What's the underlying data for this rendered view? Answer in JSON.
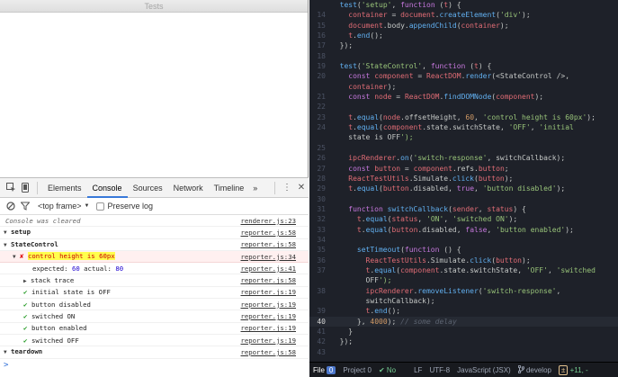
{
  "window": {
    "title": "Tests"
  },
  "devtools": {
    "tabs": [
      "Elements",
      "Console",
      "Sources",
      "Network",
      "Timeline"
    ],
    "active_tab": "Console",
    "more": "»",
    "menu": "⋮",
    "close": "✕",
    "frame": "<top frame>",
    "frame_arrow": "▼",
    "preserve_log": "Preserve log"
  },
  "console": {
    "cleared": {
      "text": "Console was cleared",
      "src": "renderer.js:23"
    },
    "setup": {
      "text": "setup",
      "src": "reporter.js:58"
    },
    "statecontrol": {
      "text": "StateControl",
      "src": "reporter.js:58"
    },
    "fail": {
      "text": "control height is 60px",
      "src": "reporter.js:34"
    },
    "expected": {
      "label_expected": "expected:",
      "expected": "60",
      "label_actual": "actual:",
      "actual": "80",
      "src": "reporter.js:41"
    },
    "stack": {
      "text": "stack trace",
      "src": "reporter.js:58"
    },
    "passes": [
      {
        "text": "initial state is OFF",
        "src": "reporter.js:19"
      },
      {
        "text": "button disabled",
        "src": "reporter.js:19"
      },
      {
        "text": "switched ON",
        "src": "reporter.js:19"
      },
      {
        "text": "button enabled",
        "src": "reporter.js:19"
      },
      {
        "text": "switched OFF",
        "src": "reporter.js:19"
      }
    ],
    "teardown": {
      "text": "teardown",
      "src": "reporter.js:58"
    },
    "prompt": ">"
  },
  "editor": {
    "colors": {
      "background": "#1e2129",
      "keyword": "#c678dd",
      "function": "#61afef",
      "string": "#98c379",
      "number": "#d19a66"
    },
    "current_line": 40,
    "lines": [
      {
        "no": "",
        "code": "  test('setup', function (t) {"
      },
      {
        "no": "14",
        "code": "    container = document.createElement('div');"
      },
      {
        "no": "15",
        "code": "    document.body.appendChild(container);"
      },
      {
        "no": "16",
        "code": "    t.end();"
      },
      {
        "no": "17",
        "code": "  });"
      },
      {
        "no": "18",
        "code": ""
      },
      {
        "no": "19",
        "code": "  test('StateControl', function (t) {"
      },
      {
        "no": "20",
        "code": "    const component = ReactDOM.render(<StateControl />,"
      },
      {
        "no": "",
        "code": "    container);"
      },
      {
        "no": "21",
        "code": "    const node = ReactDOM.findDOMNode(component);"
      },
      {
        "no": "22",
        "code": ""
      },
      {
        "no": "23",
        "code": "    t.equal(node.offsetHeight, 60, 'control height is 60px');"
      },
      {
        "no": "24",
        "code": "    t.equal(component.state.switchState, 'OFF', 'initial"
      },
      {
        "no": "",
        "code": "    state is OFF');"
      },
      {
        "no": "25",
        "code": ""
      },
      {
        "no": "26",
        "code": "    ipcRenderer.on('switch-response', switchCallback);"
      },
      {
        "no": "27",
        "code": "    const button = component.refs.button;"
      },
      {
        "no": "28",
        "code": "    ReactTestUtils.Simulate.click(button);"
      },
      {
        "no": "29",
        "code": "    t.equal(button.disabled, true, 'button disabled');"
      },
      {
        "no": "30",
        "code": ""
      },
      {
        "no": "31",
        "code": "    function switchCallback(sender, status) {"
      },
      {
        "no": "32",
        "code": "      t.equal(status, 'ON', 'switched ON');"
      },
      {
        "no": "33",
        "code": "      t.equal(button.disabled, false, 'button enabled');"
      },
      {
        "no": "34",
        "code": ""
      },
      {
        "no": "35",
        "code": "      setTimeout(function () {"
      },
      {
        "no": "36",
        "code": "        ReactTestUtils.Simulate.click(button);"
      },
      {
        "no": "37",
        "code": "        t.equal(component.state.switchState, 'OFF', 'switched"
      },
      {
        "no": "",
        "code": "        OFF');"
      },
      {
        "no": "38",
        "code": "        ipcRenderer.removeListener('switch-response',"
      },
      {
        "no": "",
        "code": "        switchCallback);"
      },
      {
        "no": "39",
        "code": "        t.end();"
      },
      {
        "no": "40",
        "code": "      }, 4000); // some delay"
      },
      {
        "no": "41",
        "code": "    }"
      },
      {
        "no": "42",
        "code": "  });"
      },
      {
        "no": "43",
        "code": ""
      }
    ]
  },
  "statusbar": {
    "file_label": "File",
    "file_count": "0",
    "project_label": "Project",
    "project_count": "0",
    "no_issues": "No",
    "line_ending": "LF",
    "encoding": "UTF-8",
    "grammar": "JavaScript (JSX)",
    "branch": "develop",
    "diff": "+11, -"
  }
}
